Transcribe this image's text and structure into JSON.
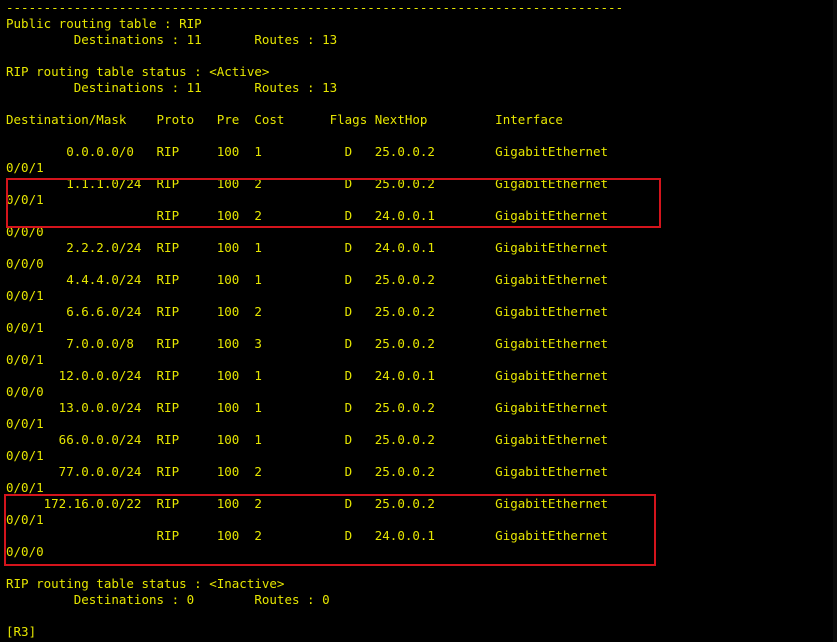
{
  "terminal": {
    "lines": [
      "----------------------------------------------------------------------------------",
      "Public routing table : RIP",
      "         Destinations : 11       Routes : 13",
      "",
      "RIP routing table status : <Active>",
      "         Destinations : 11       Routes : 13",
      "",
      "Destination/Mask    Proto   Pre  Cost      Flags NextHop         Interface",
      "",
      "        0.0.0.0/0   RIP     100  1           D   25.0.0.2        GigabitEthernet",
      "0/0/1",
      "        1.1.1.0/24  RIP     100  2           D   25.0.0.2        GigabitEthernet",
      "0/0/1",
      "                    RIP     100  2           D   24.0.0.1        GigabitEthernet",
      "0/0/0",
      "        2.2.2.0/24  RIP     100  1           D   24.0.0.1        GigabitEthernet",
      "0/0/0",
      "        4.4.4.0/24  RIP     100  1           D   25.0.0.2        GigabitEthernet",
      "0/0/1",
      "        6.6.6.0/24  RIP     100  2           D   25.0.0.2        GigabitEthernet",
      "0/0/1",
      "        7.0.0.0/8   RIP     100  3           D   25.0.0.2        GigabitEthernet",
      "0/0/1",
      "       12.0.0.0/24  RIP     100  1           D   24.0.0.1        GigabitEthernet",
      "0/0/0",
      "       13.0.0.0/24  RIP     100  1           D   25.0.0.2        GigabitEthernet",
      "0/0/1",
      "       66.0.0.0/24  RIP     100  1           D   25.0.0.2        GigabitEthernet",
      "0/0/1",
      "       77.0.0.0/24  RIP     100  2           D   25.0.0.2        GigabitEthernet",
      "0/0/1",
      "     172.16.0.0/22  RIP     100  2           D   25.0.0.2        GigabitEthernet",
      "0/0/1",
      "                    RIP     100  2           D   24.0.0.1        GigabitEthernet",
      "0/0/0",
      "",
      "RIP routing table status : <Inactive>",
      "         Destinations : 0        Routes : 0",
      "",
      "[R3]"
    ]
  },
  "colors": {
    "background": "#000000",
    "text": "#e6e600",
    "highlight": "#d4141c"
  }
}
